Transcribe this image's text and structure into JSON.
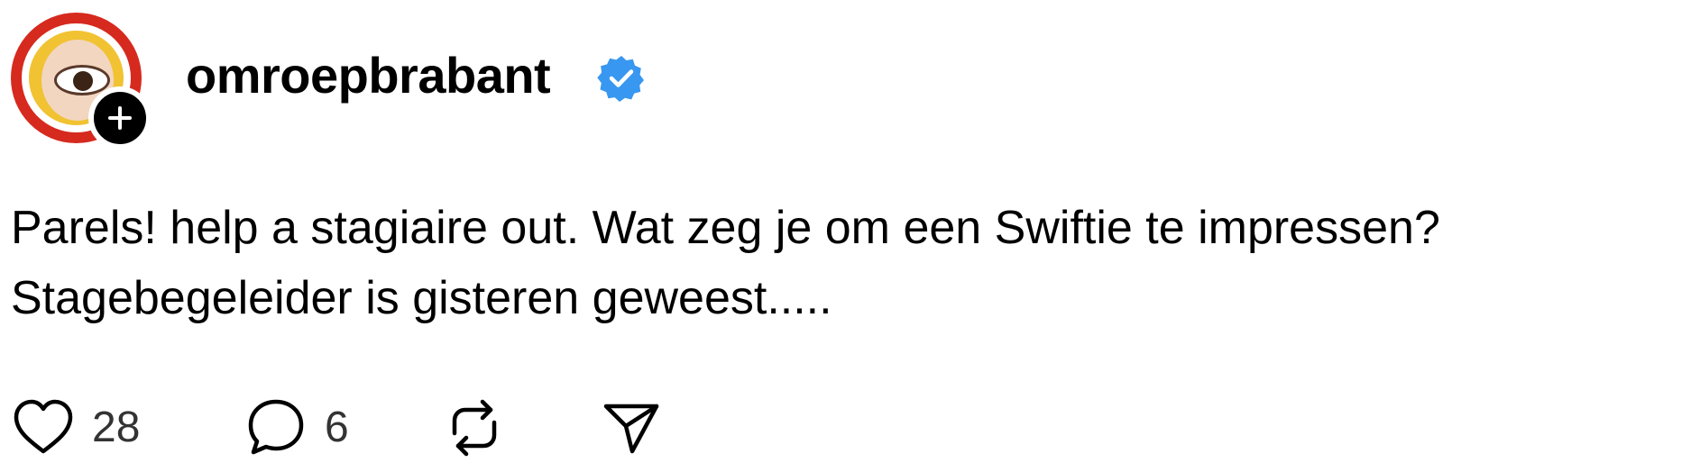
{
  "post": {
    "username": "omroepbrabant",
    "verified": true,
    "text_lines": [
      "Parels! help a stagiaire out. Wat zeg je om een Swiftie te impressen?",
      "Stagebegeleider is gisteren geweest....."
    ],
    "actions": {
      "likes": "28",
      "replies": "6"
    }
  },
  "icons": {
    "follow": "plus-icon",
    "verified": "verified-badge-icon",
    "like": "heart-icon",
    "reply": "comment-icon",
    "repost": "repost-icon",
    "share": "send-icon"
  },
  "colors": {
    "verified_blue": "#3897f0",
    "avatar_ring": "#d62a1f",
    "avatar_face": "#f1c232",
    "text": "#000000",
    "count_text": "#333333"
  }
}
